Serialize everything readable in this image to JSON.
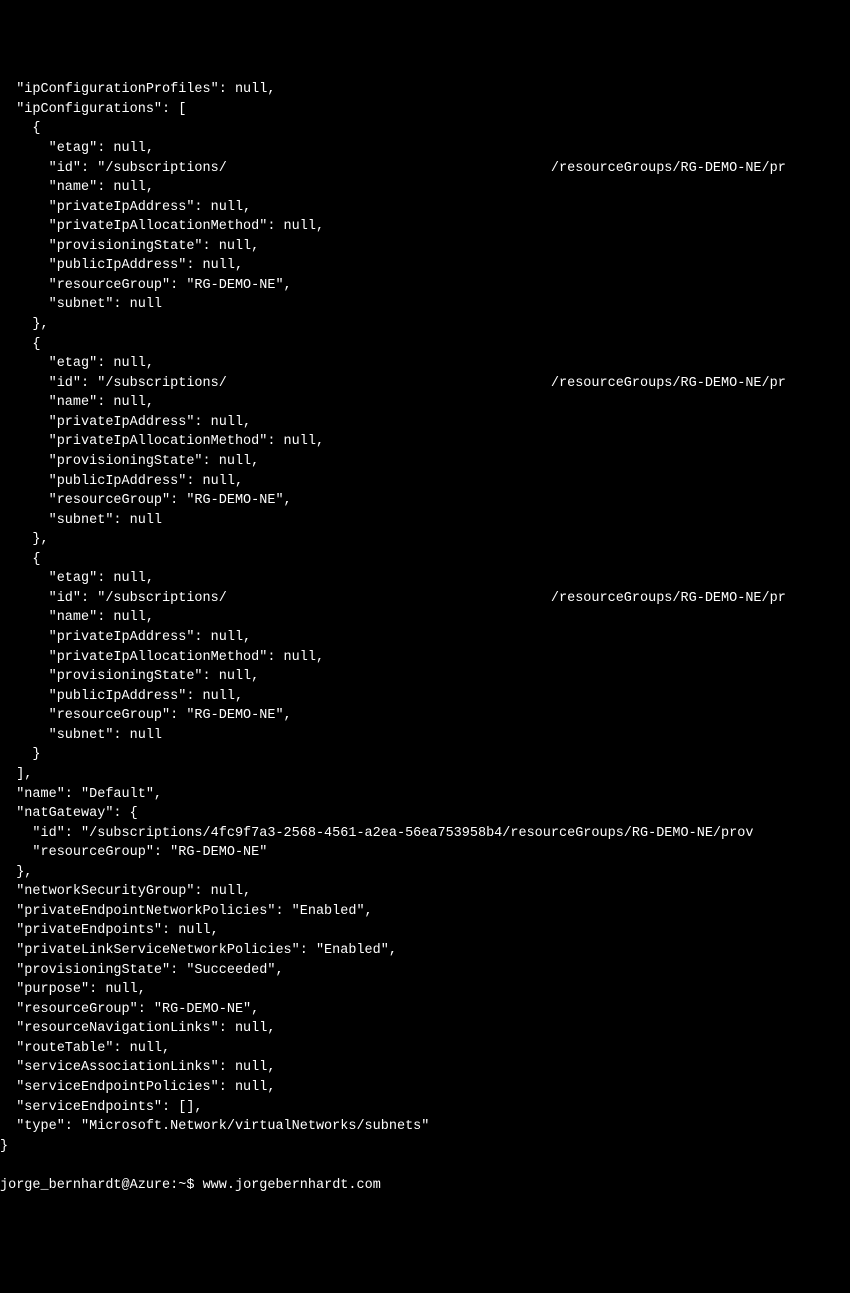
{
  "terminal": {
    "json_output": {
      "ipConfigurationProfiles": null,
      "ipConfigurations": [
        {
          "etag": null,
          "id_prefix": "/subscriptions/",
          "id_suffix": "/resourceGroups/RG-DEMO-NE/pr",
          "name": null,
          "privateIpAddress": null,
          "privateIpAllocationMethod": null,
          "provisioningState": null,
          "publicIpAddress": null,
          "resourceGroup": "RG-DEMO-NE",
          "subnet": null
        },
        {
          "etag": null,
          "id_prefix": "/subscriptions/",
          "id_suffix": "/resourceGroups/RG-DEMO-NE/pr",
          "name": null,
          "privateIpAddress": null,
          "privateIpAllocationMethod": null,
          "provisioningState": null,
          "publicIpAddress": null,
          "resourceGroup": "RG-DEMO-NE",
          "subnet": null
        },
        {
          "etag": null,
          "id_prefix": "/subscriptions/",
          "id_suffix": "/resourceGroups/RG-DEMO-NE/pr",
          "name": null,
          "privateIpAddress": null,
          "privateIpAllocationMethod": null,
          "provisioningState": null,
          "publicIpAddress": null,
          "resourceGroup": "RG-DEMO-NE",
          "subnet": null
        }
      ],
      "name": "Default",
      "natGateway": {
        "id": "/subscriptions/4fc9f7a3-2568-4561-a2ea-56ea753958b4/resourceGroups/RG-DEMO-NE/prov",
        "resourceGroup": "RG-DEMO-NE"
      },
      "networkSecurityGroup": null,
      "privateEndpointNetworkPolicies": "Enabled",
      "privateEndpoints": null,
      "privateLinkServiceNetworkPolicies": "Enabled",
      "provisioningState": "Succeeded",
      "purpose": null,
      "resourceGroup": "RG-DEMO-NE",
      "resourceNavigationLinks": null,
      "routeTable": null,
      "serviceAssociationLinks": null,
      "serviceEndpointPolicies": null,
      "serviceEndpoints": [],
      "type": "Microsoft.Network/virtualNetworks/subnets"
    },
    "prompt_user": "jorge_bernhardt@Azure",
    "prompt_path": "~",
    "prompt_symbol": "$",
    "command": "www.jorgebernhardt.com"
  },
  "rendered_lines": [
    "  \"ipConfigurationProfiles\": null,",
    "  \"ipConfigurations\": [",
    "    {",
    "      \"etag\": null,",
    "      \"id\": \"/subscriptions/                                        /resourceGroups/RG-DEMO-NE/pr",
    "      \"name\": null,",
    "      \"privateIpAddress\": null,",
    "      \"privateIpAllocationMethod\": null,",
    "      \"provisioningState\": null,",
    "      \"publicIpAddress\": null,",
    "      \"resourceGroup\": \"RG-DEMO-NE\",",
    "      \"subnet\": null",
    "    },",
    "    {",
    "      \"etag\": null,",
    "      \"id\": \"/subscriptions/                                        /resourceGroups/RG-DEMO-NE/pr",
    "      \"name\": null,",
    "      \"privateIpAddress\": null,",
    "      \"privateIpAllocationMethod\": null,",
    "      \"provisioningState\": null,",
    "      \"publicIpAddress\": null,",
    "      \"resourceGroup\": \"RG-DEMO-NE\",",
    "      \"subnet\": null",
    "    },",
    "    {",
    "      \"etag\": null,",
    "      \"id\": \"/subscriptions/                                        /resourceGroups/RG-DEMO-NE/pr",
    "      \"name\": null,",
    "      \"privateIpAddress\": null,",
    "      \"privateIpAllocationMethod\": null,",
    "      \"provisioningState\": null,",
    "      \"publicIpAddress\": null,",
    "      \"resourceGroup\": \"RG-DEMO-NE\",",
    "      \"subnet\": null",
    "    }",
    "  ],",
    "  \"name\": \"Default\",",
    "  \"natGateway\": {",
    "    \"id\": \"/subscriptions/4fc9f7a3-2568-4561-a2ea-56ea753958b4/resourceGroups/RG-DEMO-NE/prov",
    "    \"resourceGroup\": \"RG-DEMO-NE\"",
    "  },",
    "  \"networkSecurityGroup\": null,",
    "  \"privateEndpointNetworkPolicies\": \"Enabled\",",
    "  \"privateEndpoints\": null,",
    "  \"privateLinkServiceNetworkPolicies\": \"Enabled\",",
    "  \"provisioningState\": \"Succeeded\",",
    "  \"purpose\": null,",
    "  \"resourceGroup\": \"RG-DEMO-NE\",",
    "  \"resourceNavigationLinks\": null,",
    "  \"routeTable\": null,",
    "  \"serviceAssociationLinks\": null,",
    "  \"serviceEndpointPolicies\": null,",
    "  \"serviceEndpoints\": [],",
    "  \"type\": \"Microsoft.Network/virtualNetworks/subnets\"",
    "}"
  ],
  "prompt_line": "jorge_bernhardt@Azure:~$ www.jorgebernhardt.com"
}
